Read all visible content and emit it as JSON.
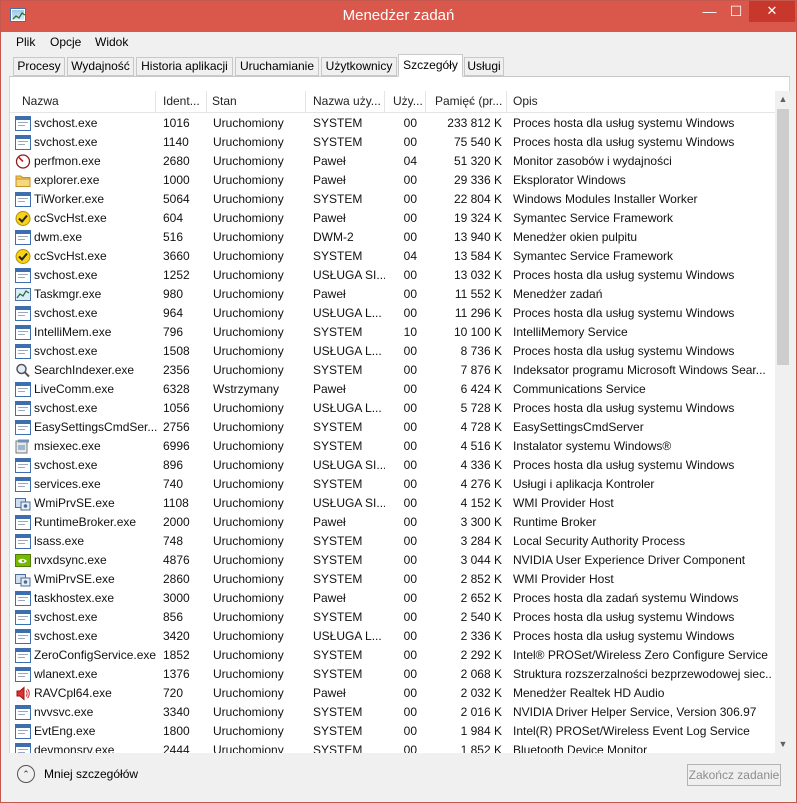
{
  "window": {
    "title": "Menedżer zadań",
    "minimize_glyph": "—",
    "maximize_glyph": "☐",
    "close_glyph": "✕"
  },
  "menu": [
    "Plik",
    "Opcje",
    "Widok"
  ],
  "tabs": [
    {
      "label": "Procesy",
      "active": false
    },
    {
      "label": "Wydajność",
      "active": false
    },
    {
      "label": "Historia aplikacji",
      "active": false
    },
    {
      "label": "Uruchamianie",
      "active": false
    },
    {
      "label": "Użytkownicy",
      "active": false
    },
    {
      "label": "Szczegóły",
      "active": true
    },
    {
      "label": "Usługi",
      "active": false
    }
  ],
  "columns": {
    "name": "Nazwa",
    "pid": "Ident...",
    "status": "Stan",
    "user": "Nazwa uży...",
    "cpu": "Uży...",
    "memory": "Pamięć (pr...",
    "description": "Opis"
  },
  "rows": [
    {
      "name": "svchost.exe",
      "pid": "1016",
      "status": "Uruchomiony",
      "user": "SYSTEM",
      "cpu": "00",
      "memory": "233 812 K",
      "description": "Proces hosta dla usług systemu Windows",
      "icon": "window-icon"
    },
    {
      "name": "svchost.exe",
      "pid": "1140",
      "status": "Uruchomiony",
      "user": "SYSTEM",
      "cpu": "00",
      "memory": "75 540 K",
      "description": "Proces hosta dla usług systemu Windows",
      "icon": "window-icon"
    },
    {
      "name": "perfmon.exe",
      "pid": "2680",
      "status": "Uruchomiony",
      "user": "Paweł",
      "cpu": "04",
      "memory": "51 320 K",
      "description": "Monitor zasobów i wydajności",
      "icon": "gauge-icon"
    },
    {
      "name": "explorer.exe",
      "pid": "1000",
      "status": "Uruchomiony",
      "user": "Paweł",
      "cpu": "00",
      "memory": "29 336 K",
      "description": "Eksplorator Windows",
      "icon": "folder-icon"
    },
    {
      "name": "TiWorker.exe",
      "pid": "5064",
      "status": "Uruchomiony",
      "user": "SYSTEM",
      "cpu": "00",
      "memory": "22 804 K",
      "description": "Windows Modules Installer Worker",
      "icon": "window-icon"
    },
    {
      "name": "ccSvcHst.exe",
      "pid": "604",
      "status": "Uruchomiony",
      "user": "Paweł",
      "cpu": "00",
      "memory": "19 324 K",
      "description": "Symantec Service Framework",
      "icon": "checkmark-icon"
    },
    {
      "name": "dwm.exe",
      "pid": "516",
      "status": "Uruchomiony",
      "user": "DWM-2",
      "cpu": "00",
      "memory": "13 940 K",
      "description": "Menedżer okien pulpitu",
      "icon": "window-icon"
    },
    {
      "name": "ccSvcHst.exe",
      "pid": "3660",
      "status": "Uruchomiony",
      "user": "SYSTEM",
      "cpu": "04",
      "memory": "13 584 K",
      "description": "Symantec Service Framework",
      "icon": "checkmark-icon"
    },
    {
      "name": "svchost.exe",
      "pid": "1252",
      "status": "Uruchomiony",
      "user": "USŁUGA SI...",
      "cpu": "00",
      "memory": "13 032 K",
      "description": "Proces hosta dla usług systemu Windows",
      "icon": "window-icon"
    },
    {
      "name": "Taskmgr.exe",
      "pid": "980",
      "status": "Uruchomiony",
      "user": "Paweł",
      "cpu": "00",
      "memory": "11 552 K",
      "description": "Menedżer zadań",
      "icon": "taskmgr-icon"
    },
    {
      "name": "svchost.exe",
      "pid": "964",
      "status": "Uruchomiony",
      "user": "USŁUGA L...",
      "cpu": "00",
      "memory": "11 296 K",
      "description": "Proces hosta dla usług systemu Windows",
      "icon": "window-icon"
    },
    {
      "name": "IntelliMem.exe",
      "pid": "796",
      "status": "Uruchomiony",
      "user": "SYSTEM",
      "cpu": "10",
      "memory": "10 100 K",
      "description": "IntelliMemory Service",
      "icon": "window-icon"
    },
    {
      "name": "svchost.exe",
      "pid": "1508",
      "status": "Uruchomiony",
      "user": "USŁUGA L...",
      "cpu": "00",
      "memory": "8 736 K",
      "description": "Proces hosta dla usług systemu Windows",
      "icon": "window-icon"
    },
    {
      "name": "SearchIndexer.exe",
      "pid": "2356",
      "status": "Uruchomiony",
      "user": "SYSTEM",
      "cpu": "00",
      "memory": "7 876 K",
      "description": "Indeksator programu Microsoft Windows Sear...",
      "icon": "search-icon"
    },
    {
      "name": "LiveComm.exe",
      "pid": "6328",
      "status": "Wstrzymany",
      "user": "Paweł",
      "cpu": "00",
      "memory": "6 424 K",
      "description": "Communications Service",
      "icon": "window-icon"
    },
    {
      "name": "svchost.exe",
      "pid": "1056",
      "status": "Uruchomiony",
      "user": "USŁUGA L...",
      "cpu": "00",
      "memory": "5 728 K",
      "description": "Proces hosta dla usług systemu Windows",
      "icon": "window-icon"
    },
    {
      "name": "EasySettingsCmdSer...",
      "pid": "2756",
      "status": "Uruchomiony",
      "user": "SYSTEM",
      "cpu": "00",
      "memory": "4 728 K",
      "description": "EasySettingsCmdServer",
      "icon": "window-icon"
    },
    {
      "name": "msiexec.exe",
      "pid": "6996",
      "status": "Uruchomiony",
      "user": "SYSTEM",
      "cpu": "00",
      "memory": "4 516 K",
      "description": "Instalator systemu Windows®",
      "icon": "installer-icon"
    },
    {
      "name": "svchost.exe",
      "pid": "896",
      "status": "Uruchomiony",
      "user": "USŁUGA SI...",
      "cpu": "00",
      "memory": "4 336 K",
      "description": "Proces hosta dla usług systemu Windows",
      "icon": "window-icon"
    },
    {
      "name": "services.exe",
      "pid": "740",
      "status": "Uruchomiony",
      "user": "SYSTEM",
      "cpu": "00",
      "memory": "4 276 K",
      "description": "Usługi i aplikacja Kontroler",
      "icon": "window-icon"
    },
    {
      "name": "WmiPrvSE.exe",
      "pid": "1108",
      "status": "Uruchomiony",
      "user": "USŁUGA SI...",
      "cpu": "00",
      "memory": "4 152 K",
      "description": "WMI Provider Host",
      "icon": "wmi-icon"
    },
    {
      "name": "RuntimeBroker.exe",
      "pid": "2000",
      "status": "Uruchomiony",
      "user": "Paweł",
      "cpu": "00",
      "memory": "3 300 K",
      "description": "Runtime Broker",
      "icon": "window-icon"
    },
    {
      "name": "lsass.exe",
      "pid": "748",
      "status": "Uruchomiony",
      "user": "SYSTEM",
      "cpu": "00",
      "memory": "3 284 K",
      "description": "Local Security Authority Process",
      "icon": "window-icon"
    },
    {
      "name": "nvxdsync.exe",
      "pid": "4876",
      "status": "Uruchomiony",
      "user": "SYSTEM",
      "cpu": "00",
      "memory": "3 044 K",
      "description": "NVIDIA User Experience Driver Component",
      "icon": "nvidia-icon"
    },
    {
      "name": "WmiPrvSE.exe",
      "pid": "2860",
      "status": "Uruchomiony",
      "user": "SYSTEM",
      "cpu": "00",
      "memory": "2 852 K",
      "description": "WMI Provider Host",
      "icon": "wmi-icon"
    },
    {
      "name": "taskhostex.exe",
      "pid": "3000",
      "status": "Uruchomiony",
      "user": "Paweł",
      "cpu": "00",
      "memory": "2 652 K",
      "description": "Proces hosta dla zadań systemu Windows",
      "icon": "window-icon"
    },
    {
      "name": "svchost.exe",
      "pid": "856",
      "status": "Uruchomiony",
      "user": "SYSTEM",
      "cpu": "00",
      "memory": "2 540 K",
      "description": "Proces hosta dla usług systemu Windows",
      "icon": "window-icon"
    },
    {
      "name": "svchost.exe",
      "pid": "3420",
      "status": "Uruchomiony",
      "user": "USŁUGA L...",
      "cpu": "00",
      "memory": "2 336 K",
      "description": "Proces hosta dla usług systemu Windows",
      "icon": "window-icon"
    },
    {
      "name": "ZeroConfigService.exe",
      "pid": "1852",
      "status": "Uruchomiony",
      "user": "SYSTEM",
      "cpu": "00",
      "memory": "2 292 K",
      "description": "Intel® PROSet/Wireless Zero Configure Service",
      "icon": "window-icon"
    },
    {
      "name": "wlanext.exe",
      "pid": "1376",
      "status": "Uruchomiony",
      "user": "SYSTEM",
      "cpu": "00",
      "memory": "2 068 K",
      "description": "Struktura rozszerzalności bezprzewodowej siec...",
      "icon": "window-icon"
    },
    {
      "name": "RAVCpl64.exe",
      "pid": "720",
      "status": "Uruchomiony",
      "user": "Paweł",
      "cpu": "00",
      "memory": "2 032 K",
      "description": "Menedżer Realtek HD Audio",
      "icon": "speaker-icon"
    },
    {
      "name": "nvvsvc.exe",
      "pid": "3340",
      "status": "Uruchomiony",
      "user": "SYSTEM",
      "cpu": "00",
      "memory": "2 016 K",
      "description": "NVIDIA Driver Helper Service, Version 306.97",
      "icon": "window-icon"
    },
    {
      "name": "EvtEng.exe",
      "pid": "1800",
      "status": "Uruchomiony",
      "user": "SYSTEM",
      "cpu": "00",
      "memory": "1 984 K",
      "description": "Intel(R) PROSet/Wireless Event Log Service",
      "icon": "window-icon"
    },
    {
      "name": "devmonsrv.exe",
      "pid": "2444",
      "status": "Uruchomiony",
      "user": "SYSTEM",
      "cpu": "00",
      "memory": "1 852 K",
      "description": "Bluetooth Device Monitor",
      "icon": "window-icon"
    }
  ],
  "footer": {
    "fewer_details": "Mniej szczegółów",
    "end_task": "Zakończ zadanie"
  }
}
